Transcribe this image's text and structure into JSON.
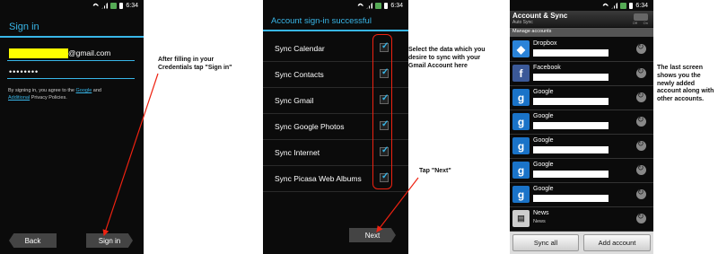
{
  "status_bar": {
    "time": "6:34"
  },
  "screen1": {
    "title": "Sign in",
    "email_domain": "@gmail.com",
    "password_mask": "••••••••",
    "terms": {
      "before": "By signing in, you agree to the ",
      "google_link": "Google",
      "middle": " and ",
      "additional_link": "Additional",
      "after": " Privacy Policies."
    },
    "back_label": "Back",
    "signin_label": "Sign in"
  },
  "annotation1": "After filling in your Credentials tap \"Sign in\"",
  "screen2": {
    "title": "Account sign-in successful",
    "items": [
      {
        "label": "Sync Calendar"
      },
      {
        "label": "Sync Contacts"
      },
      {
        "label": "Sync Gmail"
      },
      {
        "label": "Sync Google Photos"
      },
      {
        "label": "Sync Internet"
      },
      {
        "label": "Sync Picasa Web Albums"
      }
    ],
    "next_label": "Next"
  },
  "annotation2": "Select the data which you desire to sync with your Gmail Account here",
  "annotation3": "Tap \"Next\"",
  "screen3": {
    "title": "Account & Sync",
    "subtitle": "Auto Sync",
    "toggle_off": "Off",
    "toggle_on": "On",
    "section": "Manage accounts",
    "accounts": [
      {
        "name": "Dropbox",
        "icon": "dropbox-icon",
        "color": "#2a83d8",
        "sub": ""
      },
      {
        "name": "Facebook",
        "icon": "facebook-icon",
        "color": "#3b5998",
        "sub": ""
      },
      {
        "name": "Google",
        "icon": "google-icon",
        "color": "#1a73c8",
        "sub": ""
      },
      {
        "name": "Google",
        "icon": "google-icon",
        "color": "#1a73c8",
        "sub": ""
      },
      {
        "name": "Google",
        "icon": "google-icon",
        "color": "#1a73c8",
        "sub": ""
      },
      {
        "name": "Google",
        "icon": "google-icon",
        "color": "#1a73c8",
        "sub": ""
      },
      {
        "name": "Google",
        "icon": "google-icon",
        "color": "#1a73c8",
        "sub": ""
      },
      {
        "name": "News",
        "icon": "news-icon",
        "color": "#cccccc",
        "sub": "News"
      }
    ],
    "sync_all": "Sync all",
    "add_account": "Add account"
  },
  "annotation4": "The last screen shows you the newly added account along with other accounts."
}
